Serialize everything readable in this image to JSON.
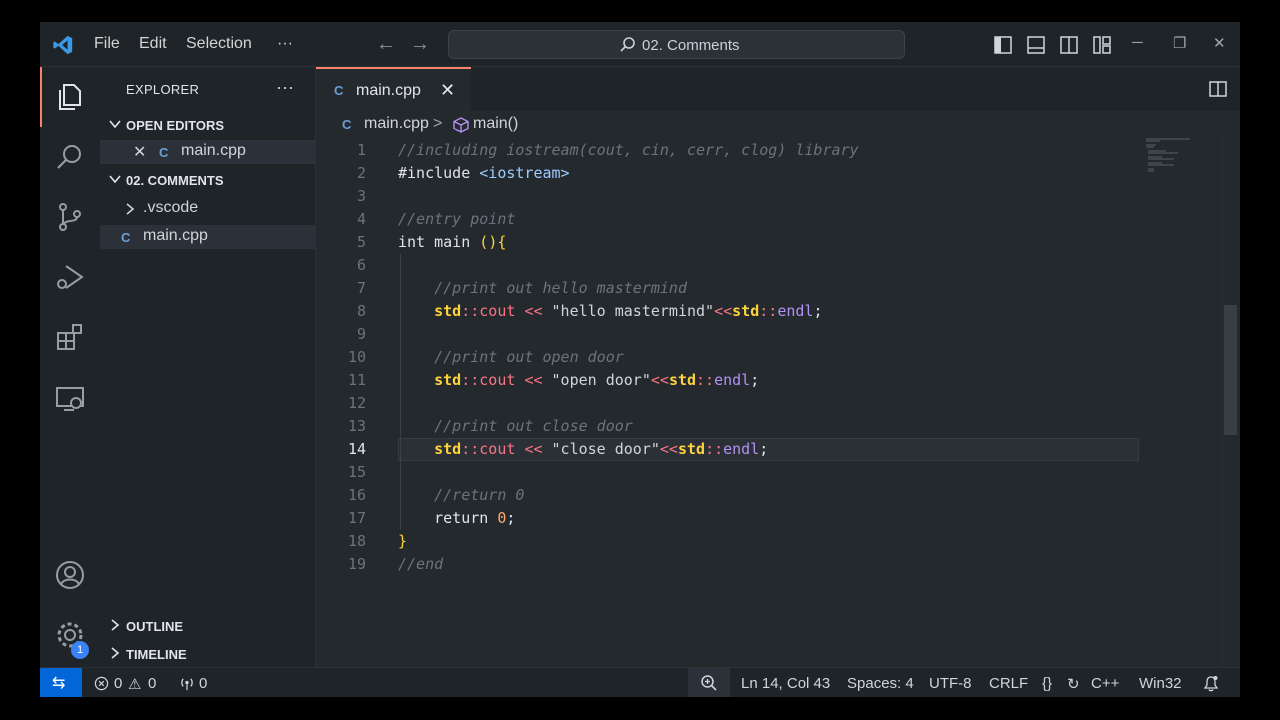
{
  "titlebar": {
    "menu": [
      "File",
      "Edit",
      "Selection",
      "···"
    ],
    "search_text": "02. Comments"
  },
  "sidebar": {
    "title": "EXPLORER",
    "more": "···",
    "open_editors_label": "OPEN EDITORS",
    "open_editors": [
      {
        "close": "✕",
        "label": "main.cpp"
      }
    ],
    "folder_label": "02. COMMENTS",
    "tree": [
      {
        "label": ".vscode",
        "type": "folder"
      },
      {
        "label": "main.cpp",
        "type": "file"
      }
    ],
    "outline_label": "OUTLINE",
    "timeline_label": "TIMELINE"
  },
  "activity": {
    "badge_count": "1"
  },
  "editor": {
    "tab": {
      "label": "main.cpp",
      "close": "✕"
    },
    "breadcrumb": {
      "file": "main.cpp",
      "separator": ">",
      "symbol": "main()"
    },
    "current_line": 14,
    "lines": [
      {
        "n": "1",
        "text": "//including iostream(cout, cin, cerr, clog) library"
      },
      {
        "n": "2",
        "text": "#include <iostream>"
      },
      {
        "n": "3",
        "text": ""
      },
      {
        "n": "4",
        "text": "//entry point"
      },
      {
        "n": "5",
        "text": "int main (){"
      },
      {
        "n": "6",
        "text": ""
      },
      {
        "n": "7",
        "text": "    //print out hello mastermind"
      },
      {
        "n": "8",
        "text": "    std::cout << \"hello mastermind\"<<std::endl;"
      },
      {
        "n": "9",
        "text": ""
      },
      {
        "n": "10",
        "text": "    //print out open door"
      },
      {
        "n": "11",
        "text": "    std::cout << \"open door\"<<std::endl;"
      },
      {
        "n": "12",
        "text": ""
      },
      {
        "n": "13",
        "text": "    //print out close door"
      },
      {
        "n": "14",
        "text": "    std::cout << \"close door\"<<std::endl;"
      },
      {
        "n": "15",
        "text": ""
      },
      {
        "n": "16",
        "text": "    //return 0"
      },
      {
        "n": "17",
        "text": "    return 0;"
      },
      {
        "n": "18",
        "text": "}"
      },
      {
        "n": "19",
        "text": "//end"
      }
    ]
  },
  "statusbar": {
    "errors": "0",
    "warnings": "0",
    "ports": "0",
    "position": "Ln 14, Col 43",
    "spaces": "Spaces: 4",
    "encoding": "UTF-8",
    "eol": "CRLF",
    "brackets": "{}",
    "language": "C++",
    "platform": "Win32"
  },
  "colors": {
    "accent": "#f9826c",
    "remote": "#0366d6",
    "badge": "#3a82f7"
  }
}
